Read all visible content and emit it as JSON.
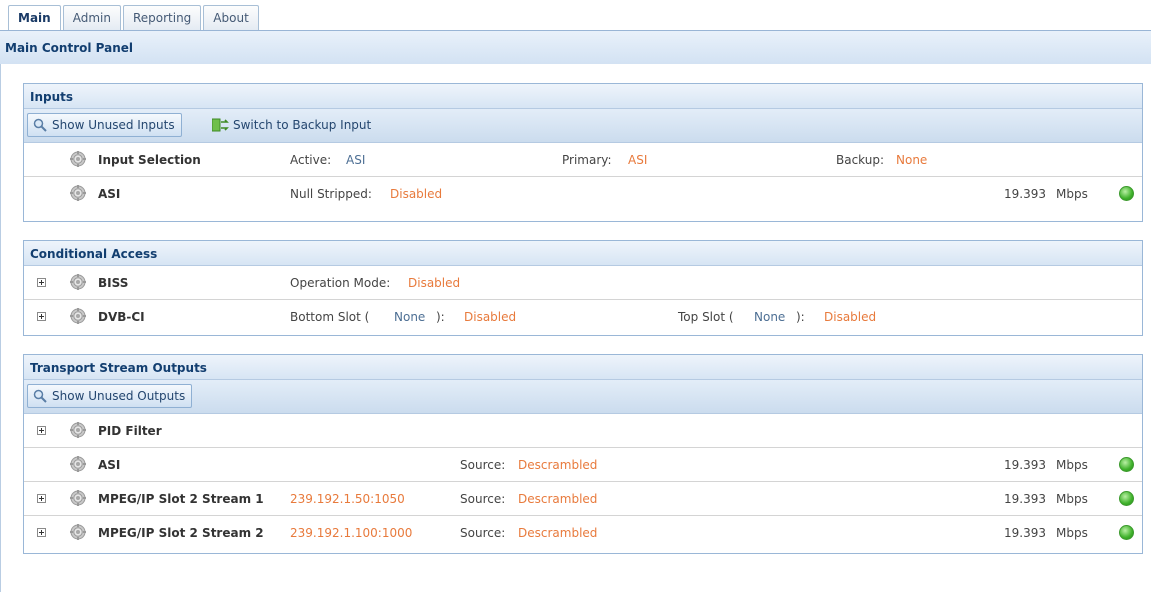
{
  "tabs": [
    {
      "label": "Main",
      "active": true
    },
    {
      "label": "Admin",
      "active": false
    },
    {
      "label": "Reporting",
      "active": false
    },
    {
      "label": "About",
      "active": false
    }
  ],
  "panel": {
    "title": "Main Control Panel"
  },
  "inputs": {
    "title": "Inputs",
    "show_unused_label": "Show Unused Inputs",
    "switch_backup_label": "Switch to Backup Input",
    "rows": [
      {
        "name": "Input Selection",
        "active_label": "Active:",
        "active_value": "ASI",
        "primary_label": "Primary:",
        "primary_value": "ASI",
        "backup_label": "Backup:",
        "backup_value": "None"
      },
      {
        "name": "ASI",
        "null_label": "Null Stripped:",
        "null_value": "Disabled",
        "rate": "19.393",
        "unit": "Mbps"
      }
    ]
  },
  "ca": {
    "title": "Conditional Access",
    "rows": [
      {
        "name": "BISS",
        "mode_label": "Operation Mode:",
        "mode_value": "Disabled"
      },
      {
        "name": "DVB-CI",
        "bottom_label": "Bottom Slot  (",
        "bottom_slot": "None",
        "bottom_close": "):",
        "bottom_value": "Disabled",
        "top_label": "Top Slot  (",
        "top_slot": "None",
        "top_close": "):",
        "top_value": "Disabled"
      }
    ]
  },
  "outputs": {
    "title": "Transport Stream Outputs",
    "show_unused_label": "Show Unused Outputs",
    "rows": [
      {
        "name": "PID Filter"
      },
      {
        "name": "ASI",
        "source_label": "Source:",
        "source_value": "Descrambled",
        "rate": "19.393",
        "unit": "Mbps"
      },
      {
        "name": "MPEG/IP Slot 2 Stream 1",
        "address": "239.192.1.50:1050",
        "source_label": "Source:",
        "source_value": "Descrambled",
        "rate": "19.393",
        "unit": "Mbps"
      },
      {
        "name": "MPEG/IP Slot 2 Stream 2",
        "address": "239.192.1.100:1000",
        "source_label": "Source:",
        "source_value": "Descrambled",
        "rate": "19.393",
        "unit": "Mbps"
      }
    ]
  },
  "colors": {
    "accent": "#e87a3c",
    "header_text": "#123e70",
    "status_ok": "#3fb12b"
  },
  "icons": [
    "search-icon",
    "switch-icon",
    "gear-icon",
    "expand-icon",
    "status-led-icon"
  ]
}
